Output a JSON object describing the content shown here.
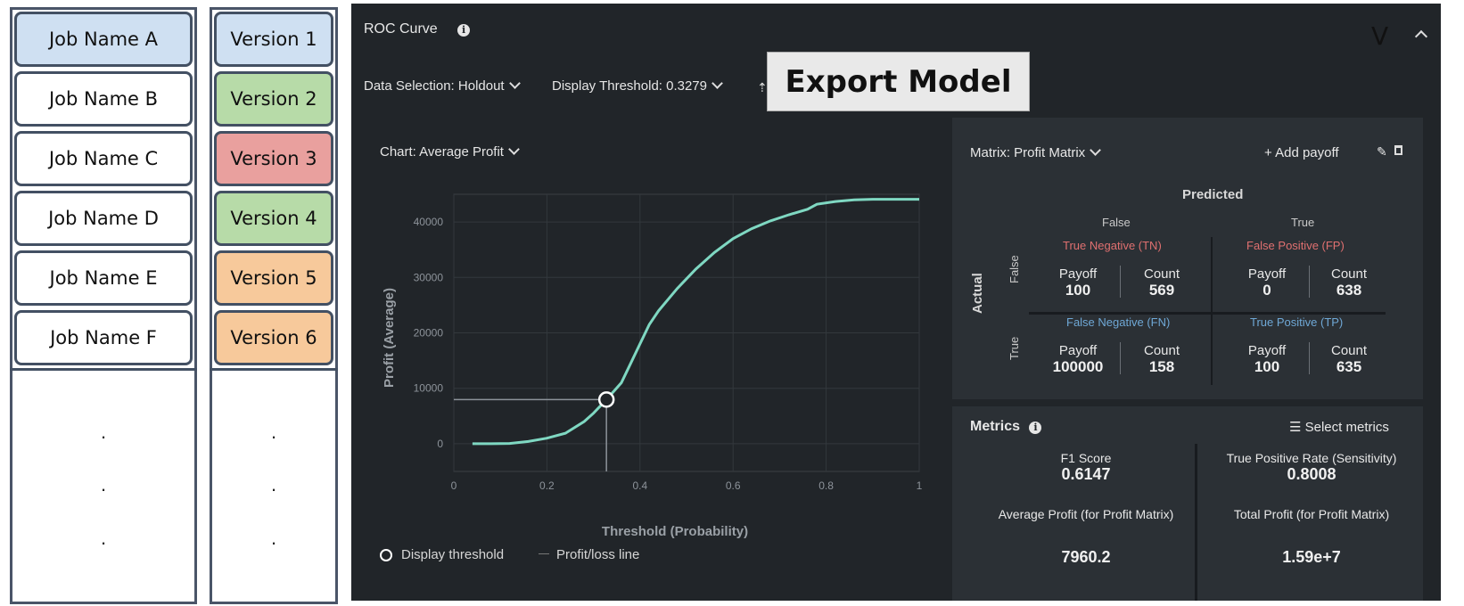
{
  "jobs": {
    "items": [
      "Job Name A",
      "Job Name B",
      "Job Name C",
      "Job Name D",
      "Job Name E",
      "Job Name F"
    ],
    "colors": [
      "#cfe0f2",
      "#ffffff",
      "#ffffff",
      "#ffffff",
      "#ffffff",
      "#ffffff"
    ],
    "ellipsis": ".",
    "ellipsis_count": 3
  },
  "versions": {
    "items": [
      "Version 1",
      "Version 2",
      "Version 3",
      "Version 4",
      "Version 5",
      "Version 6"
    ],
    "colors": [
      "#cfe0f2",
      "#b7dba8",
      "#e9a09e",
      "#b7dba8",
      "#f7c99b",
      "#f7c99b"
    ],
    "ellipsis": ".",
    "ellipsis_count": 3
  },
  "panel": {
    "title": "ROC Curve",
    "collapse_v": "V",
    "data_selection": "Data Selection: Holdout",
    "display_threshold": "Display Threshold: 0.3279",
    "export_label": "Export Model",
    "chart_selector": "Chart: Average Profit",
    "legend": {
      "threshold": "Display threshold",
      "line": "Profit/loss line"
    }
  },
  "chart_data": {
    "type": "line",
    "title": "",
    "xlabel": "Threshold (Probability)",
    "ylabel": "Profit (Average)",
    "xlim": [
      0,
      1
    ],
    "ylim": [
      -5000,
      45000
    ],
    "x_ticks": [
      "0",
      "0.2",
      "0.4",
      "0.6",
      "0.8",
      "1"
    ],
    "y_ticks": [
      "0",
      "10000",
      "20000",
      "30000",
      "40000"
    ],
    "series": [
      {
        "x": [
          0.04,
          0.08,
          0.12,
          0.16,
          0.2,
          0.24,
          0.28,
          0.3,
          0.3279,
          0.36,
          0.38,
          0.4,
          0.42,
          0.44,
          0.48,
          0.52,
          0.56,
          0.6,
          0.64,
          0.68,
          0.72,
          0.76,
          0.78,
          0.82,
          0.86,
          0.9,
          1.0
        ],
        "values": [
          0,
          0,
          50,
          400,
          1000,
          1900,
          4000,
          5500,
          7960,
          11000,
          14500,
          18000,
          21500,
          24000,
          28000,
          31500,
          34500,
          37000,
          38800,
          40200,
          41300,
          42300,
          43200,
          43700,
          44000,
          44100,
          44100
        ]
      }
    ],
    "highlight": {
      "x": 0.3279,
      "y": 7960.2
    },
    "color": "#7fd8c2"
  },
  "matrix": {
    "selector": "Matrix: Profit Matrix",
    "add_payoff": "+ Add payoff",
    "predicted": "Predicted",
    "actual": "Actual",
    "col_false": "False",
    "col_true": "True",
    "row_false": "False",
    "row_true": "True",
    "tn": {
      "label": "True Negative (TN)",
      "payoff_label": "Payoff",
      "payoff": "100",
      "count_label": "Count",
      "count": "569"
    },
    "fp": {
      "label": "False Positive (FP)",
      "payoff_label": "Payoff",
      "payoff": "0",
      "count_label": "Count",
      "count": "638"
    },
    "fn": {
      "label": "False Negative (FN)",
      "payoff_label": "Payoff",
      "payoff": "100000",
      "count_label": "Count",
      "count": "158"
    },
    "tp": {
      "label": "True Positive (TP)",
      "payoff_label": "Payoff",
      "payoff": "100",
      "count_label": "Count",
      "count": "635"
    },
    "neg_color": "#e07070",
    "pos_color": "#6fa8d6"
  },
  "metrics": {
    "title": "Metrics",
    "select": "Select metrics",
    "f1_label": "F1 Score",
    "f1_value": "0.6147",
    "tpr_label": "True Positive Rate (Sensitivity)",
    "tpr_value": "0.8008",
    "avg_label": "Average Profit (for Profit Matrix)",
    "avg_value": "7960.2",
    "total_label": "Total Profit (for Profit Matrix)",
    "total_value": "1.59e+7"
  }
}
